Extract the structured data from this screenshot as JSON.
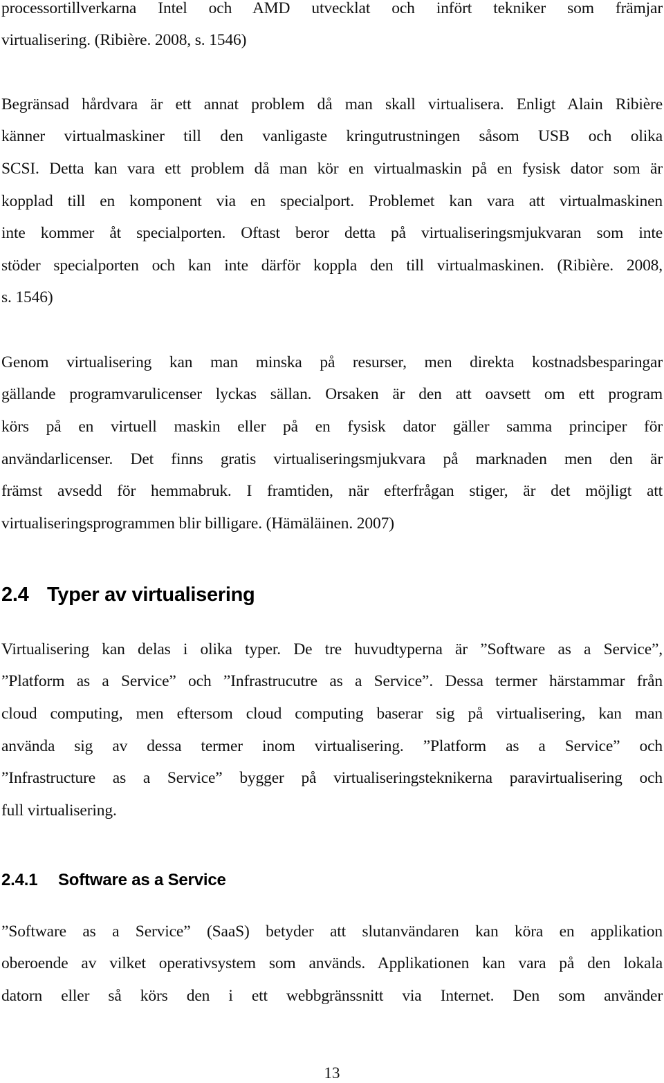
{
  "document": {
    "page_number": "13",
    "blocks": [
      {
        "type": "paragraph",
        "lines": [
          "processortillverkarna Intel och AMD utvecklat och infört tekniker som främjar",
          "virtualisering. (Ribière. 2008, s. 1546)"
        ]
      },
      {
        "type": "paragraph",
        "lines": [
          "Begränsad hårdvara är ett annat problem då man skall virtualisera. Enligt Alain Ribière",
          "känner virtualmaskiner till den vanligaste kringutrustningen såsom USB och olika",
          "SCSI. Detta kan vara ett problem då man kör en virtualmaskin på en fysisk dator som är",
          "kopplad till en komponent via en specialport. Problemet kan vara att virtualmaskinen",
          "inte kommer åt specialporten. Oftast beror detta på virtualiseringsmjukvaran som inte",
          "stöder specialporten och kan inte därför koppla den till virtualmaskinen. (Ribière. 2008,",
          "s. 1546)"
        ]
      },
      {
        "type": "paragraph",
        "lines": [
          "Genom virtualisering kan man minska på resurser, men direkta kostnadsbesparingar",
          "gällande programvarulicenser lyckas sällan. Orsaken är den att oavsett om ett program",
          "körs på en virtuell maskin eller på en fysisk dator gäller samma principer för",
          "användarlicenser. Det finns gratis virtualiseringsmjukvara på marknaden men den är",
          "främst avsedd för hemmabruk. I framtiden, när efterfrågan stiger, är det möjligt att",
          "virtualiseringsprogrammen blir billigare. (Hämäläinen. 2007)"
        ]
      },
      {
        "type": "heading2",
        "number": "2.4",
        "title": "Typer av virtualisering"
      },
      {
        "type": "paragraph",
        "lines": [
          "Virtualisering kan delas i olika typer. De tre huvudtyperna är ”Software as a Service”,",
          "”Platform as a Service” och ”Infrastrucutre as a Service”. Dessa termer härstammar från",
          "cloud computing, men eftersom cloud computing baserar sig på virtualisering, kan man",
          "använda sig av dessa termer inom virtualisering. ”Platform as a Service” och",
          "”Infrastructure as a Service” bygger på virtualiseringsteknikerna paravirtualisering och",
          "full virtualisering."
        ]
      },
      {
        "type": "heading3",
        "number": "2.4.1",
        "title": "Software as a Service"
      },
      {
        "type": "paragraph",
        "lines": [
          "”Software as a Service” (SaaS) betyder att slutanvändaren kan köra en applikation",
          "oberoende av vilket operativsystem som används. Applikationen kan vara på den lokala",
          "datorn eller så körs den i ett webbgränssnitt via Internet. Den som använder"
        ]
      }
    ]
  }
}
